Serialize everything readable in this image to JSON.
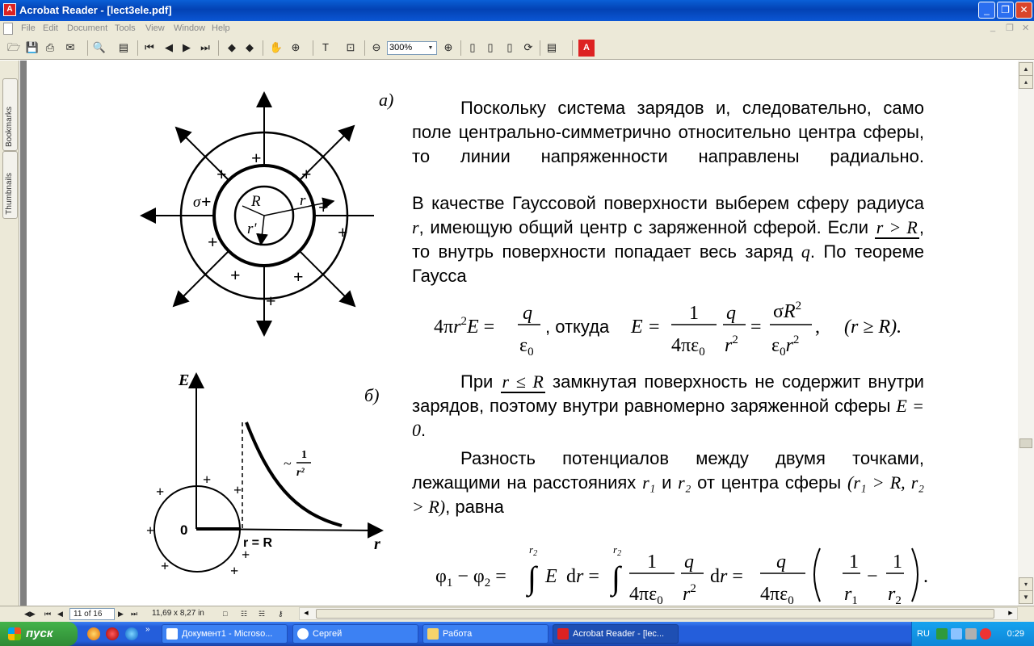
{
  "window": {
    "title": "Acrobat Reader - [lect3ele.pdf]",
    "app_icon": "acrobat-icon"
  },
  "menu": {
    "items": [
      "File",
      "Edit",
      "Document",
      "Tools",
      "View",
      "Window",
      "Help"
    ]
  },
  "toolbar": {
    "zoom_value": "300%"
  },
  "sidebar": {
    "tabs": [
      "Bookmarks",
      "Thumbnails"
    ]
  },
  "document": {
    "fig_a_label": "а)",
    "fig_b_label": "б)",
    "fig_a": {
      "sigma": "σ",
      "R": "R",
      "r": "r",
      "r_prime": "r'",
      "plus": "+"
    },
    "fig_b": {
      "E": "E",
      "zero": "0",
      "r_eq_R": "r = R",
      "r": "r",
      "approx": "~",
      "one": "1",
      "r2": "r²",
      "plus": "+"
    },
    "para1": "Поскольку система зарядов и, следовательно, само поле центрально-симметрично относительно центра сферы, то линии напряженности направлены радиально.",
    "para2a": "В качестве Гауссовой поверхности выберем сферу радиуса",
    "para2b": ", имеющую общий центр с заряженной сферой. Если",
    "para2c": ", то внутрь поверхности попадает весь заряд",
    "para2d": ". По теореме Гаусса",
    "var_r": "r",
    "var_q": "q",
    "cond_rgtR": "r > R",
    "formula1_mid": ", откуда",
    "formula1_range": "(r ≥ R).",
    "para3a": "При",
    "cond_rleR": "r ≤ R",
    "para3b": "замкнутая поверхность не содержит внутри зарядов, поэтому внутри равномерно заряженной сферы",
    "E_eq_0": "E = 0",
    "para4a": "Разность потенциалов между двумя точками, лежащими на расстояниях",
    "r1": "r₁",
    "and": "и",
    "r2": "r₂",
    "para4b": "от центра сферы",
    "para4c": "(r₁ > R, r₂ > R)",
    "para4d": ", равна"
  },
  "status": {
    "page": "11 of 16",
    "size": "11,69 x 8,27 in"
  },
  "taskbar": {
    "start": "пуск",
    "tasks": [
      "Документ1 - Microso...",
      "Сергей",
      "Работа",
      "Acrobat Reader - [lec..."
    ],
    "lang": "RU",
    "clock": "0:29"
  }
}
